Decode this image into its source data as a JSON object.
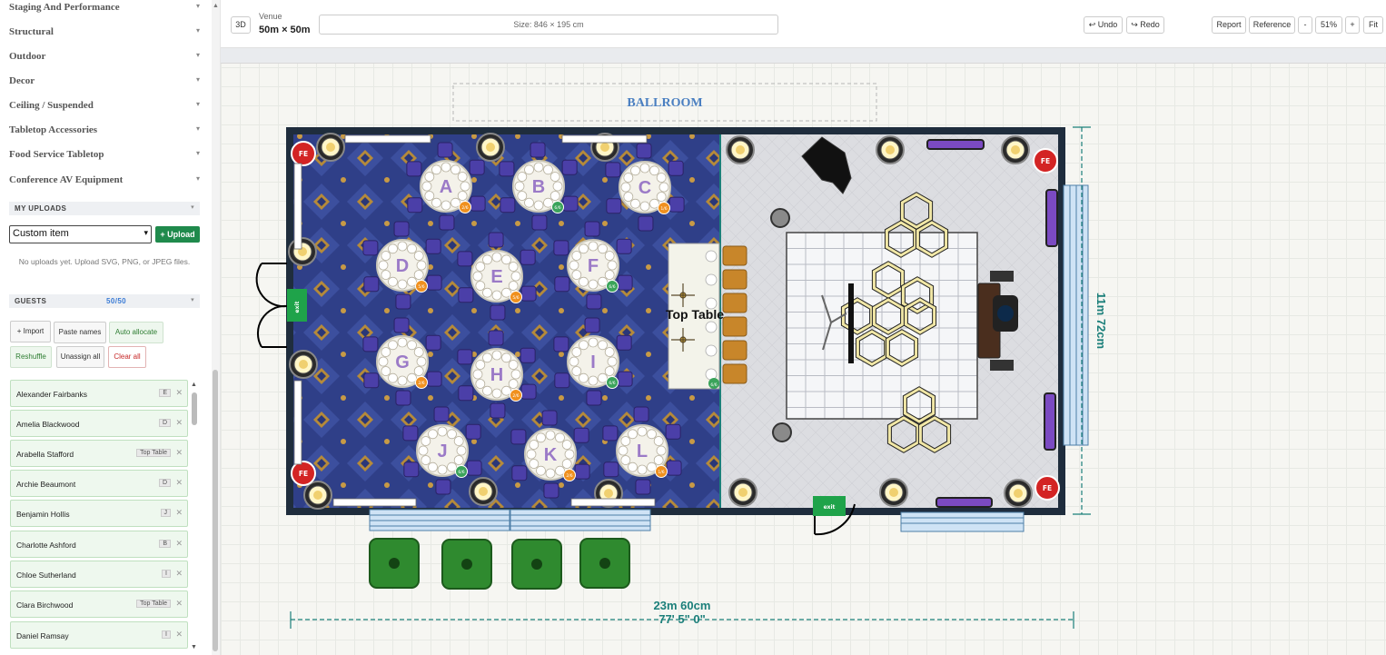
{
  "sidebar": {
    "categories": [
      "Staging And Performance",
      "Structural",
      "Outdoor",
      "Decor",
      "Ceiling / Suspended",
      "Tabletop Accessories",
      "Food Service Tabletop",
      "Conference AV Equipment"
    ],
    "uploads": {
      "title": "MY UPLOADS",
      "select_value": "Custom item",
      "upload_label": "+ Upload",
      "empty_text": "No uploads yet. Upload SVG, PNG, or JPEG files."
    },
    "guests": {
      "title": "GUESTS",
      "count": "50/50",
      "buttons": {
        "import": "+ Import",
        "paste": "Paste names",
        "auto": "Auto allocate",
        "reshuffle": "Reshuffle",
        "unassign": "Unassign all",
        "clear": "Clear all"
      },
      "list": [
        {
          "name": "Alexander Fairbanks",
          "table": "E"
        },
        {
          "name": "Amelia Blackwood",
          "table": "D"
        },
        {
          "name": "Arabella Stafford",
          "table": "Top Table"
        },
        {
          "name": "Archie Beaumont",
          "table": "D"
        },
        {
          "name": "Benjamin Hollis",
          "table": "J"
        },
        {
          "name": "Charlotte Ashford",
          "table": "B"
        },
        {
          "name": "Chloe Sutherland",
          "table": "I"
        },
        {
          "name": "Clara Birchwood",
          "table": "Top Table"
        },
        {
          "name": "Daniel Ramsay",
          "table": "I"
        }
      ]
    }
  },
  "toolbar": {
    "view3d": "3D",
    "venue_label": "Venue",
    "venue_size": "50m × 50m",
    "size_display": "Size: 846 × 195 cm",
    "undo": "↩ Undo",
    "redo": "↪ Redo",
    "report": "Report",
    "reference": "Reference",
    "zoom_out": "-",
    "zoom": "51%",
    "zoom_in": "+",
    "fit": "Fit"
  },
  "floorplan": {
    "room_label": "BALLROOM",
    "top_table_label": "Top Table",
    "width_label": "23m 60cm",
    "width_imperial": "77' 5\" 0\"",
    "height_label": "11m 72cm",
    "fire_label": "FE",
    "exit_label": "exit",
    "tables": [
      {
        "letter": "A",
        "seats": "2/6",
        "full": false
      },
      {
        "letter": "B",
        "seats": "6/6",
        "full": true
      },
      {
        "letter": "C",
        "seats": "1/6",
        "full": false
      },
      {
        "letter": "D",
        "seats": "5/6",
        "full": false
      },
      {
        "letter": "E",
        "seats": "5/6",
        "full": false
      },
      {
        "letter": "F",
        "seats": "6/6",
        "full": true
      },
      {
        "letter": "G",
        "seats": "2/6",
        "full": false
      },
      {
        "letter": "H",
        "seats": "2/6",
        "full": false
      },
      {
        "letter": "I",
        "seats": "6/6",
        "full": true
      },
      {
        "letter": "J",
        "seats": "6/6",
        "full": true
      },
      {
        "letter": "K",
        "seats": "2/6",
        "full": false
      },
      {
        "letter": "L",
        "seats": "1/6",
        "full": false
      }
    ],
    "top_table_seats": "6/6",
    "colors": {
      "wall": "#1f2d3d",
      "carpet": "#2e3f86",
      "accent": "#1b7f7a",
      "badge_full": "#3aa35a",
      "badge_partial": "#f0901e",
      "fire": "#d32424",
      "exit_green": "#1fa34a"
    }
  }
}
